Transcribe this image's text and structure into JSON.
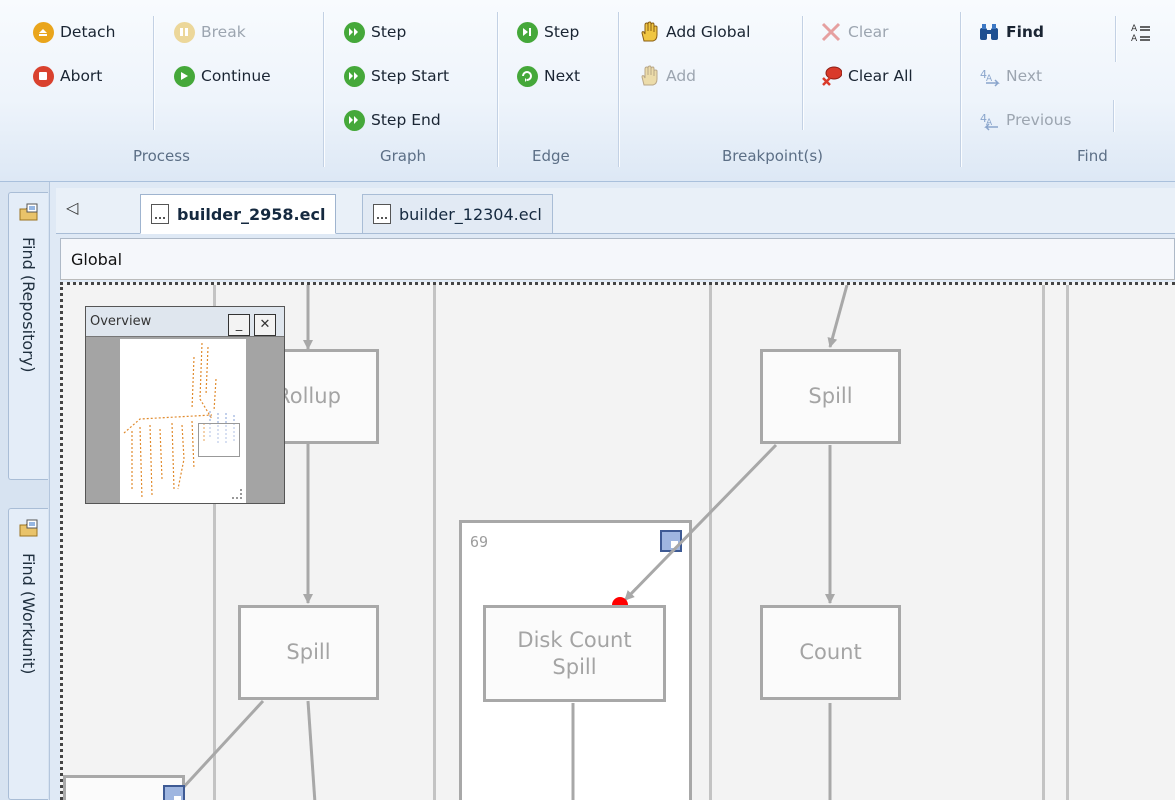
{
  "ribbon": {
    "process": {
      "label": "Process",
      "detach": "Detach",
      "abort": "Abort",
      "break": "Break",
      "continue": "Continue"
    },
    "graph": {
      "label": "Graph",
      "step": "Step",
      "step_start": "Step Start",
      "step_end": "Step End"
    },
    "edge": {
      "label": "Edge",
      "step": "Step",
      "next": "Next"
    },
    "breakpoints": {
      "label": "Breakpoint(s)",
      "add_global": "Add Global",
      "add": "Add",
      "clear": "Clear",
      "clear_all": "Clear All"
    },
    "find": {
      "label": "Find",
      "find": "Find",
      "next": "Next",
      "previous": "Previous"
    }
  },
  "dock": {
    "tab_repository": "Find (Repository)",
    "tab_workunit": "Find (Workunit)"
  },
  "tabs": [
    {
      "label": "builder_2958.ecl",
      "active": true
    },
    {
      "label": "builder_12304.ecl",
      "active": false
    }
  ],
  "global_bar": {
    "label": "Global"
  },
  "overview": {
    "title": "Overview"
  },
  "graph": {
    "nodes": {
      "rollup": "Rollup",
      "spill_top": "Spill",
      "spill_left": "Spill",
      "disk_count_spill": "Disk Count\nSpill",
      "count": "Count"
    },
    "cluster_id": "69"
  },
  "colors": {
    "breakpoint": "#ff0000",
    "edge": "#a8a8a8",
    "node_border": "#a8a8a8",
    "overview_map": "#e08a2c"
  }
}
